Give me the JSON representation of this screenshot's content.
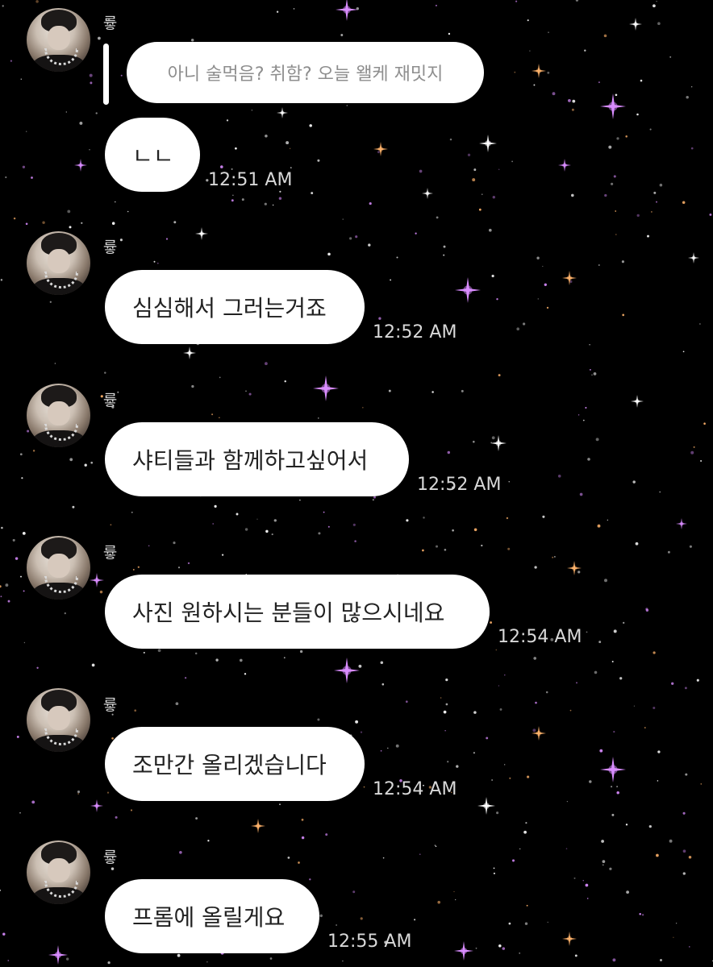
{
  "sender_name": "륳",
  "reply": {
    "quoted_text": "아니 술먹음? 취함? 오늘 왤케 재밋지"
  },
  "messages": [
    {
      "text": "ㄴㄴ",
      "time": "12:51 AM"
    },
    {
      "text": "심심해서 그러는거죠",
      "time": "12:52 AM"
    },
    {
      "text": "샤티들과 함께하고싶어서",
      "time": "12:52 AM"
    },
    {
      "text": "사진 원하시는 분들이 많으시네요",
      "time": "12:54 AM"
    },
    {
      "text": "조만간 올리겠습니다",
      "time": "12:54 AM"
    },
    {
      "text": "프롬에 올릴게요",
      "time": "12:55 AM"
    }
  ],
  "colors": {
    "background": "#000000",
    "bubble": "#ffffff",
    "text": "#222222",
    "timestamp": "#d8d8d8",
    "star_purple": "#d98cff",
    "star_white": "#ffffff",
    "star_orange": "#ffb36b"
  }
}
